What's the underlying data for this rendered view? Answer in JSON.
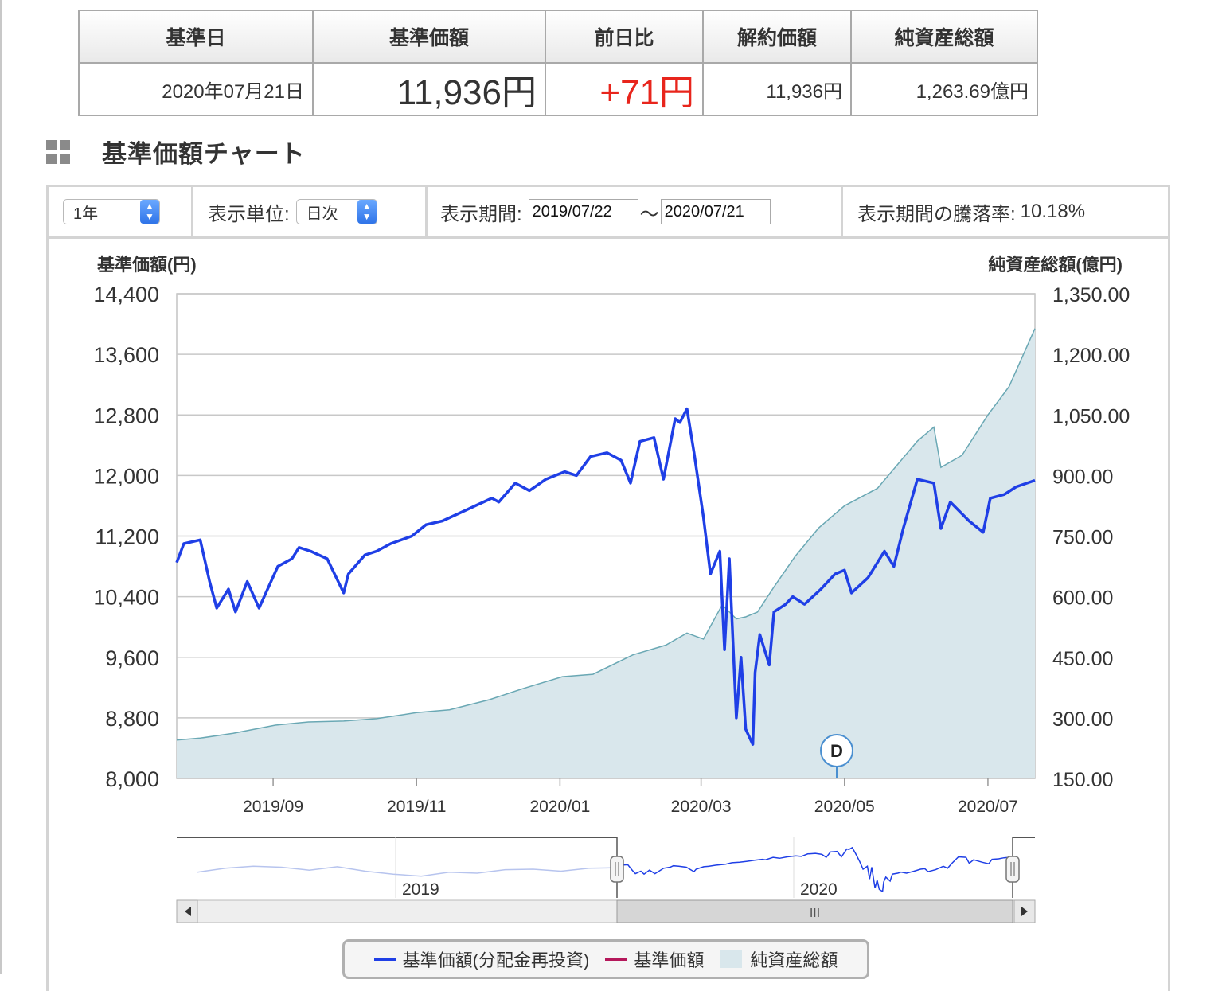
{
  "summary": {
    "headers": [
      "基準日",
      "基準価額",
      "前日比",
      "解約価額",
      "純資産総額"
    ],
    "date": "2020年07月21日",
    "nav": "11,936円",
    "change": "+71円",
    "cancel_price": "11,936円",
    "net_assets": "1,263.69億円"
  },
  "section_title": "基準価額チャート",
  "controls": {
    "period_select": "1年",
    "unit_label": "表示単位:",
    "unit_select": "日次",
    "range_label": "表示期間:",
    "range_start": "2019/07/22",
    "range_sep": "〜",
    "range_end": "2020/07/21",
    "change_label": "表示期間の騰落率:",
    "change_value": "10.18%"
  },
  "colors": {
    "nav_line": "#1f3fe6",
    "nav_plain": "#b5185b",
    "area_fill": "#d9e7ec",
    "area_line": "#6aa8b4",
    "change_red": "#e8251c"
  },
  "chart_data": {
    "type": "line",
    "ylabel_left": "基準価額(円)",
    "ylabel_right": "純資産総額(億円)",
    "ylim_left": [
      8000,
      14400
    ],
    "ylim_right": [
      150,
      1350
    ],
    "yticks_left": [
      "14,400",
      "13,600",
      "12,800",
      "12,000",
      "11,200",
      "10,400",
      "9,600",
      "8,800",
      "8,000"
    ],
    "yticks_right": [
      "1,350.00",
      "1,200.00",
      "1,050.00",
      "900.00",
      "750.00",
      "600.00",
      "450.00",
      "300.00",
      "150.00"
    ],
    "xticks": [
      "2019/09",
      "2019/11",
      "2020/01",
      "2020/03",
      "2020/05",
      "2020/07"
    ],
    "xlim": [
      "2019/07/22",
      "2020/07/21"
    ],
    "grid": true,
    "marker": "D",
    "navigator_labels": [
      "2019",
      "2020"
    ],
    "series": [
      {
        "name": "基準価額(分配金再投資)",
        "axis": "left",
        "x": [
          "2019/07/22",
          "2019/07/25",
          "2019/08/01",
          "2019/08/05",
          "2019/08/08",
          "2019/08/13",
          "2019/08/16",
          "2019/08/21",
          "2019/08/26",
          "2019/09/03",
          "2019/09/09",
          "2019/09/12",
          "2019/09/17",
          "2019/09/24",
          "2019/10/01",
          "2019/10/03",
          "2019/10/10",
          "2019/10/15",
          "2019/10/21",
          "2019/10/30",
          "2019/11/05",
          "2019/11/12",
          "2019/11/19",
          "2019/11/26",
          "2019/12/03",
          "2019/12/06",
          "2019/12/13",
          "2019/12/19",
          "2019/12/26",
          "2020/01/03",
          "2020/01/08",
          "2020/01/14",
          "2020/01/21",
          "2020/01/27",
          "2020/01/31",
          "2020/02/04",
          "2020/02/10",
          "2020/02/14",
          "2020/02/19",
          "2020/02/21",
          "2020/02/24",
          "2020/02/27",
          "2020/03/02",
          "2020/03/05",
          "2020/03/09",
          "2020/03/11",
          "2020/03/13",
          "2020/03/16",
          "2020/03/18",
          "2020/03/20",
          "2020/03/23",
          "2020/03/24",
          "2020/03/26",
          "2020/03/30",
          "2020/04/01",
          "2020/04/06",
          "2020/04/09",
          "2020/04/14",
          "2020/04/21",
          "2020/04/27",
          "2020/05/01",
          "2020/05/04",
          "2020/05/11",
          "2020/05/18",
          "2020/05/22",
          "2020/05/26",
          "2020/06/01",
          "2020/06/08",
          "2020/06/11",
          "2020/06/15",
          "2020/06/23",
          "2020/06/29",
          "2020/07/02",
          "2020/07/08",
          "2020/07/13",
          "2020/07/21"
        ],
        "values": [
          10850,
          11100,
          11150,
          10600,
          10250,
          10500,
          10200,
          10600,
          10250,
          10800,
          10900,
          11050,
          11000,
          10900,
          10450,
          10700,
          10950,
          11000,
          11100,
          11200,
          11350,
          11400,
          11500,
          11600,
          11700,
          11650,
          11900,
          11800,
          11950,
          12050,
          12000,
          12250,
          12300,
          12200,
          11900,
          12450,
          12500,
          11950,
          12750,
          12700,
          12880,
          12300,
          11450,
          10700,
          11000,
          9700,
          10900,
          8800,
          9600,
          8650,
          8450,
          9400,
          9900,
          9500,
          10200,
          10300,
          10400,
          10300,
          10500,
          10700,
          10750,
          10450,
          10650,
          11000,
          10800,
          11300,
          11950,
          11900,
          11300,
          11650,
          11400,
          11250,
          11700,
          11750,
          11850,
          11936
        ]
      },
      {
        "name": "基準価額",
        "axis": "left",
        "x": [],
        "values": []
      },
      {
        "name": "純資産総額",
        "axis": "right",
        "type": "area",
        "x": [
          "2019/07/22",
          "2019/08/01",
          "2019/08/15",
          "2019/09/02",
          "2019/09/16",
          "2019/10/01",
          "2019/10/15",
          "2019/11/01",
          "2019/11/15",
          "2019/12/02",
          "2019/12/16",
          "2020/01/02",
          "2020/01/15",
          "2020/02/01",
          "2020/02/15",
          "2020/02/24",
          "2020/03/02",
          "2020/03/10",
          "2020/03/16",
          "2020/03/20",
          "2020/03/25",
          "2020/04/01",
          "2020/04/10",
          "2020/04/20",
          "2020/05/01",
          "2020/05/15",
          "2020/06/01",
          "2020/06/08",
          "2020/06/11",
          "2020/06/20",
          "2020/07/01",
          "2020/07/10",
          "2020/07/21"
        ],
        "values": [
          245,
          250,
          262,
          282,
          290,
          292,
          298,
          313,
          320,
          345,
          372,
          402,
          408,
          456,
          480,
          510,
          495,
          580,
          545,
          550,
          562,
          624,
          700,
          770,
          825,
          868,
          985,
          1020,
          920,
          950,
          1050,
          1120,
          1263.69
        ]
      }
    ]
  },
  "legend": {
    "items": [
      "基準価額(分配金再投資)",
      "基準価額",
      "純資産総額"
    ]
  },
  "navigator": {
    "handle": "III"
  }
}
